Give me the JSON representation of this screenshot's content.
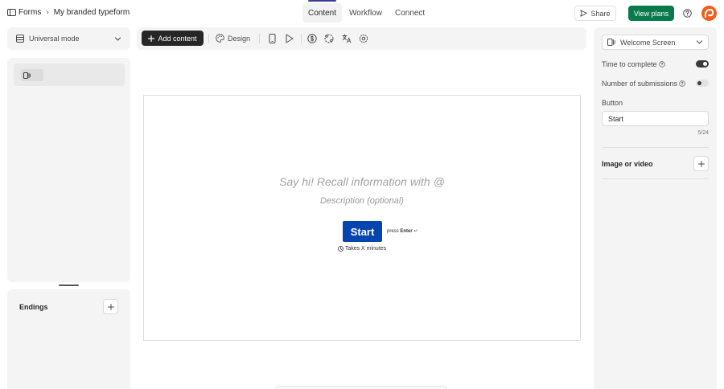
{
  "breadcrumb": {
    "root": "Forms",
    "current": "My branded typeform"
  },
  "tabs": [
    {
      "label": "Content",
      "active": true
    },
    {
      "label": "Workflow",
      "active": false
    },
    {
      "label": "Connect",
      "active": false
    }
  ],
  "header": {
    "share_label": "Share",
    "view_plans_label": "View plans"
  },
  "sidebar": {
    "mode_label": "Universal mode",
    "endings_label": "Endings"
  },
  "toolbar": {
    "add_content_label": "Add content",
    "design_label": "Design"
  },
  "canvas": {
    "headline_placeholder": "Say hi! Recall information with @",
    "description_placeholder": "Description (optional)",
    "start_button_label": "Start",
    "press_label": "press",
    "enter_label": "Enter",
    "enter_symbol": "↵",
    "duration_text": "Takes X minutes",
    "button_color": "#0445af"
  },
  "settings": {
    "screen_type": "Welcome Screen",
    "time_to_complete_label": "Time to complete",
    "time_to_complete_enabled": true,
    "submissions_label": "Number of submissions",
    "submissions_enabled": false,
    "button_label": "Button",
    "button_value": "Start",
    "button_counter": "5/24",
    "media_label": "Image or video"
  },
  "colors": {
    "accent_green": "#0a7a4d",
    "avatar_orange": "#f25c19",
    "tab_indicator": "#3b3b9e"
  }
}
